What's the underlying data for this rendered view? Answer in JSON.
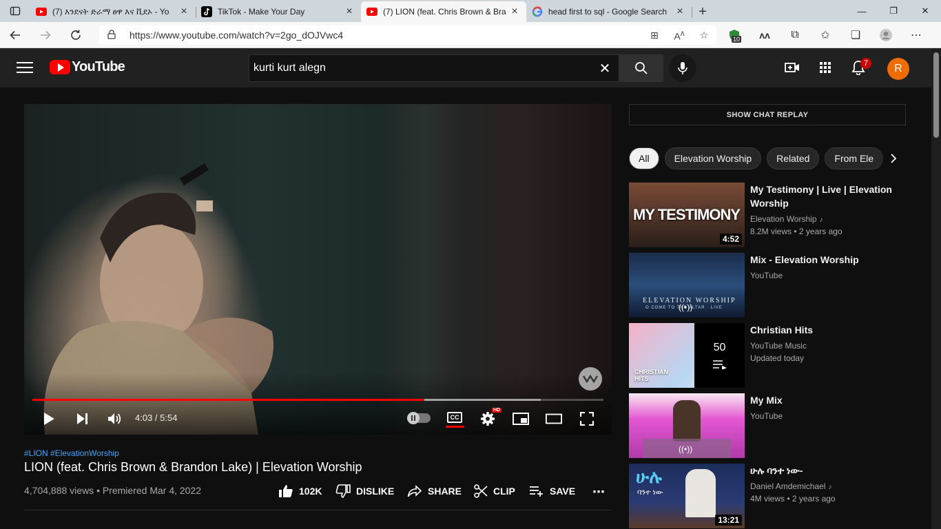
{
  "browser": {
    "tabs": [
      {
        "title": "(7) እንደናት ድራማ ፀዋ እና ቪደኦ - Yo",
        "favicon": "youtube-icon"
      },
      {
        "title": "TikTok - Make Your Day",
        "favicon": "tiktok-icon"
      },
      {
        "title": "(7) LION (feat. Chris Brown & Bra",
        "favicon": "youtube-icon"
      },
      {
        "title": "head first to sql - Google Search",
        "favicon": "google-icon"
      }
    ],
    "url": "https://www.youtube.com/watch?v=2go_dOJVwc4",
    "extension_badge": "10"
  },
  "youtube": {
    "logo_text": "YouTube",
    "search_query": "kurti kurt alegn",
    "notification_count": "7",
    "avatar_letter": "R"
  },
  "player": {
    "time": "4:03 / 5:54",
    "played_fraction": 0.6864,
    "loaded_fraction": 0.89,
    "cc_label": "CC",
    "hd_label": "HD"
  },
  "video": {
    "hashtags": "#LION #ElevationWorship",
    "title": "LION (feat. Chris Brown & Brandon Lake) | Elevation Worship",
    "meta": "4,704,888 views • Premiered Mar 4, 2022",
    "likes": "102K",
    "dislike_label": "DISLIKE",
    "share_label": "SHARE",
    "clip_label": "CLIP",
    "save_label": "SAVE"
  },
  "sidebar": {
    "chat_replay_label": "SHOW CHAT REPLAY",
    "chips": [
      "All",
      "Elevation Worship",
      "Related",
      "From Ele"
    ],
    "recommendations": [
      {
        "title": "My Testimony | Live | Elevation Worship",
        "channel": "Elevation Worship",
        "stats": "8.2M views • 2 years ago",
        "duration": "4:52",
        "thumb_text": "MY TESTIMONY"
      },
      {
        "title": "Mix - Elevation Worship",
        "channel": "YouTube",
        "stats": "",
        "duration": "",
        "thumb_text": "ELEVATION WORSHIP",
        "thumb_sub": "O COME TO THE ALTAR · LIVE"
      },
      {
        "title": "Christian Hits",
        "channel": "YouTube Music",
        "stats": "Updated today",
        "playlist_count": "50",
        "thumb_text": "CHRISTIAN HITS"
      },
      {
        "title": "My Mix",
        "channel": "YouTube",
        "stats": ""
      },
      {
        "title": "ሁሉ ባንተ ነው-",
        "channel": "Daniel Amdemichael",
        "stats": "4M views • 2 years ago",
        "duration": "13:21",
        "thumb_text": "ሁሉ",
        "thumb_sub": "ባንተ ነው"
      }
    ]
  }
}
